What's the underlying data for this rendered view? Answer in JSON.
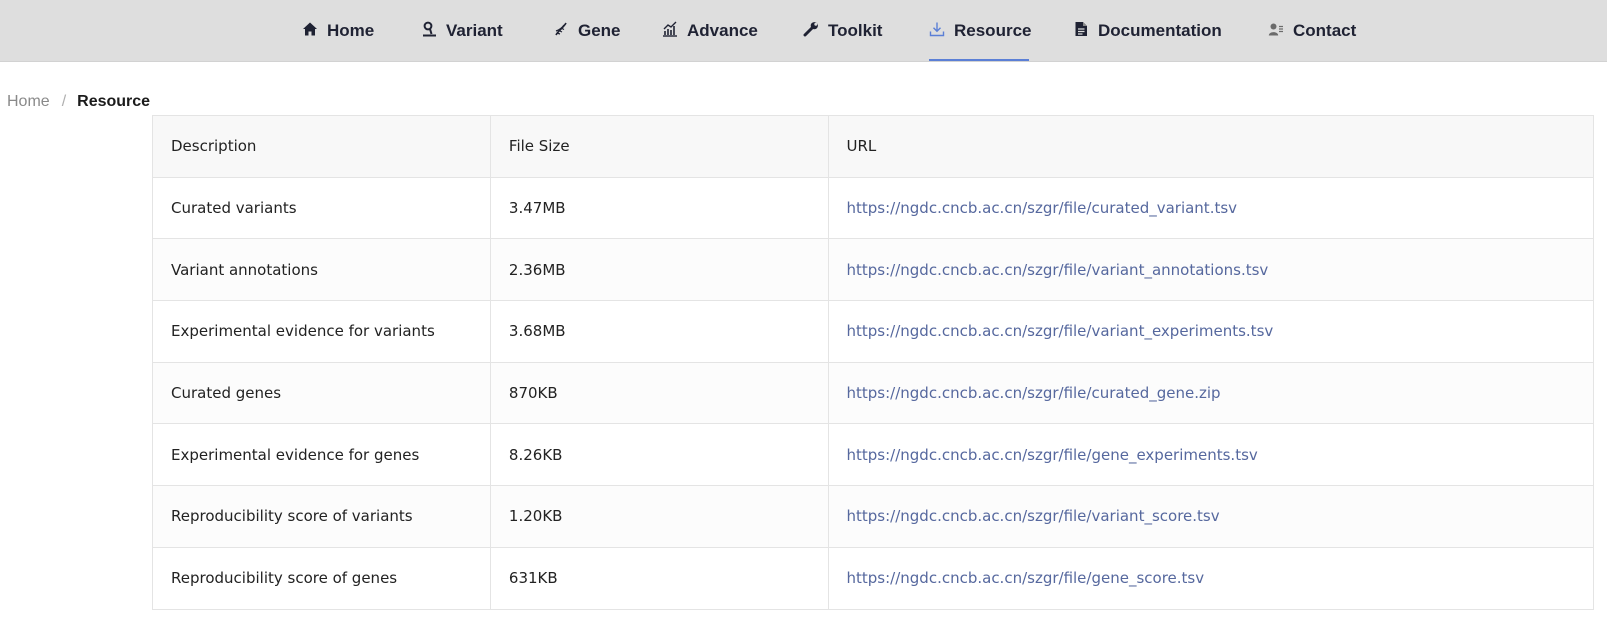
{
  "nav": {
    "items": [
      {
        "label": "Home",
        "icon": "home-icon"
      },
      {
        "label": "Variant",
        "icon": "variant-icon"
      },
      {
        "label": "Gene",
        "icon": "gene-icon"
      },
      {
        "label": "Advance",
        "icon": "chart-icon"
      },
      {
        "label": "Toolkit",
        "icon": "wrench-icon"
      },
      {
        "label": "Resource",
        "icon": "download-icon",
        "active": true
      },
      {
        "label": "Documentation",
        "icon": "document-icon"
      },
      {
        "label": "Contact",
        "icon": "contact-icon"
      }
    ],
    "accent_color": "#5b7fd6"
  },
  "breadcrumb": {
    "home": "Home",
    "separator": "/",
    "current": "Resource"
  },
  "table": {
    "headers": [
      "Description",
      "File Size",
      "URL"
    ],
    "rows": [
      {
        "description": "Curated variants",
        "size": "3.47MB",
        "url": "https://ngdc.cncb.ac.cn/szgr/file/curated_variant.tsv"
      },
      {
        "description": "Variant annotations",
        "size": "2.36MB",
        "url": "https://ngdc.cncb.ac.cn/szgr/file/variant_annotations.tsv"
      },
      {
        "description": "Experimental evidence for variants",
        "size": "3.68MB",
        "url": "https://ngdc.cncb.ac.cn/szgr/file/variant_experiments.tsv"
      },
      {
        "description": "Curated genes",
        "size": "870KB",
        "url": "https://ngdc.cncb.ac.cn/szgr/file/curated_gene.zip"
      },
      {
        "description": "Experimental evidence for genes",
        "size": "8.26KB",
        "url": "https://ngdc.cncb.ac.cn/szgr/file/gene_experiments.tsv"
      },
      {
        "description": "Reproducibility score of variants",
        "size": "1.20KB",
        "url": "https://ngdc.cncb.ac.cn/szgr/file/variant_score.tsv"
      },
      {
        "description": "Reproducibility score of genes",
        "size": "631KB",
        "url": "https://ngdc.cncb.ac.cn/szgr/file/gene_score.tsv"
      }
    ],
    "link_color": "#56689e"
  }
}
